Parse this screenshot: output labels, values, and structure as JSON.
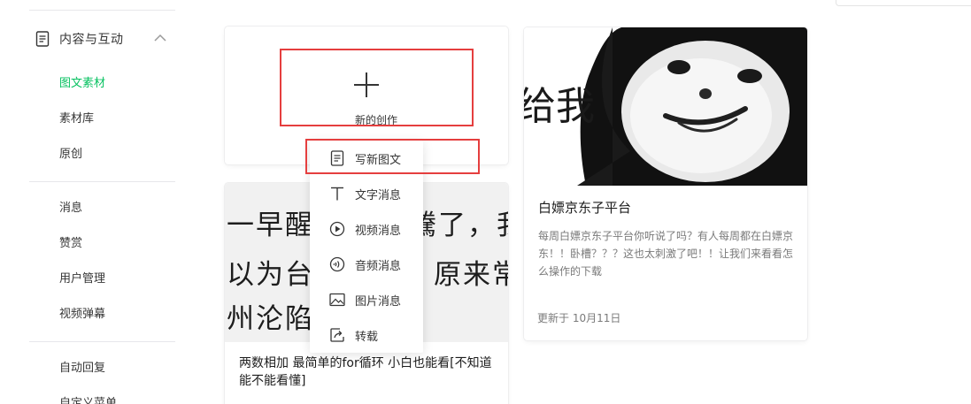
{
  "sidebar": {
    "section_title": "内容与互动",
    "group1": [
      {
        "label": "图文素材",
        "active": true
      },
      {
        "label": "素材库",
        "active": false
      },
      {
        "label": "原创",
        "active": false
      }
    ],
    "group2": [
      {
        "label": "消息"
      },
      {
        "label": "赞赏"
      },
      {
        "label": "用户管理"
      },
      {
        "label": "视频弹幕"
      }
    ],
    "group3": [
      {
        "label": "自动回复"
      },
      {
        "label": "自定义菜单"
      }
    ]
  },
  "create_card": {
    "label": "新的创作"
  },
  "dropdown": {
    "items": [
      {
        "label": "写新图文",
        "icon": "document-icon"
      },
      {
        "label": "文字消息",
        "icon": "text-icon"
      },
      {
        "label": "视频消息",
        "icon": "play-circle-icon"
      },
      {
        "label": "音频消息",
        "icon": "audio-icon"
      },
      {
        "label": "图片消息",
        "icon": "image-icon"
      },
      {
        "label": "转载",
        "icon": "repost-icon"
      }
    ]
  },
  "article_card": {
    "image_lines": [
      "一早醒来",
      "騰了，我",
      "以为台湾",
      "原来常",
      "州沦陷了"
    ],
    "title": "两数相加 最简单的for循环 小白也能看[不知道能不能看懂]"
  },
  "meme_card": {
    "image_text": "给我",
    "title": "白嫖京东子平台",
    "description": "每周白嫖京东子平台你听说了吗？有人每周都在白嫖京东！！卧槽？？？这也太刺激了吧！！让我们来看看怎么操作的下载",
    "updated": "更新于 10月11日"
  },
  "colors": {
    "accent": "#07c160",
    "highlight_border": "#e53e3e",
    "text": "#353535",
    "muted": "#7a7a7a"
  }
}
